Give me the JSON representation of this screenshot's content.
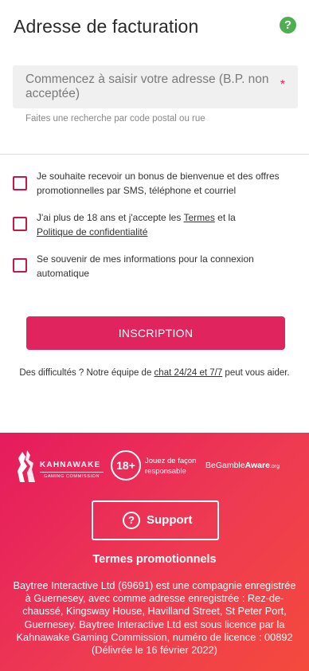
{
  "header": {
    "title": "Adresse de facturation",
    "help_icon": "?"
  },
  "address": {
    "placeholder": "Commencez à saisir votre adresse (B.P. non acceptée)",
    "required_mark": "*",
    "helper": "Faites une recherche par code postal ou rue"
  },
  "checkboxes": [
    {
      "label": "Je souhaite recevoir un bonus de bienvenue et des offres promotionnelles par SMS, téléphone et courriel"
    },
    {
      "label_pre": "J'ai plus de 18 ans et j'accepte les ",
      "terms_link": "Termes",
      "label_mid": " et la ",
      "privacy_link": "Politique de confidentialité"
    },
    {
      "label": "Se souvenir de mes informations pour la connexion automatique"
    }
  ],
  "cta": {
    "label": "INSCRIPTION"
  },
  "help": {
    "pre": "Des difficultés ? Notre équipe de ",
    "link": "chat 24/24 et 7/7",
    "post": " peut vous aider."
  },
  "footer": {
    "kahnawake": {
      "name": "KAHNAWAKE",
      "sub": "GAMING COMMISSION"
    },
    "age": {
      "badge": "18+",
      "text": "Jouez de façon responsable"
    },
    "gamble_aware": {
      "be": "BeGamble",
      "aware": "Aware",
      "org": ".org"
    },
    "support": {
      "icon": "?",
      "label": "Support"
    },
    "promo_title": "Termes promotionnels",
    "legal": "Baytree Interactive Ltd (69691) est une compagnie enregistrée à Guernesey, avec comme adresse enregistrée : Rez-de-chaussé, Kingsway House, Havilland Street, St Peter Port, Guernesey. Baytree Interactive Ltd est sous licence par la Kahnawake Gaming Commission, numéro de licence : 00892 (Délivrée le 16 février 2022)"
  },
  "colors": {
    "accent": "#e0245e",
    "checkbox": "#c8174b",
    "help": "#4caf50"
  }
}
